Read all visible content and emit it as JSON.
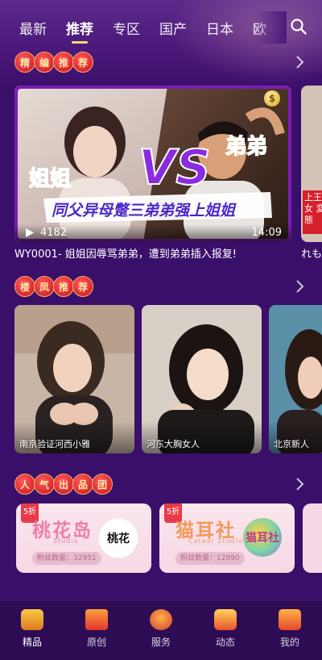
{
  "colors": {
    "background": "#3a0f6a",
    "accent": "#f4d67d",
    "section_bubble": "#c8121d",
    "featured_frame": "#7a1fb0"
  },
  "top_tabs": [
    "最新",
    "推荐",
    "专区",
    "国产",
    "日本",
    "欧"
  ],
  "active_tab": "推荐",
  "search_icon": "search-icon",
  "sections": {
    "featured": {
      "title_chars": [
        "精",
        "编",
        "推",
        "荐"
      ],
      "card": {
        "plays": "4182",
        "duration": "14:09",
        "caption": "WY0001- 姐姐因辱骂弟弟，遭到弟弟插入报复!",
        "poster": {
          "left_tag": "姐姐",
          "vs": "VS",
          "right_tag": "弟弟",
          "banner": "同父异母蹩三弟弟强上姐姐"
        }
      },
      "peek_card": {
        "caption": "れも",
        "poster_text": "上王 女 変態"
      }
    },
    "hot": {
      "title_chars": [
        "楼",
        "凤",
        "推",
        "荐"
      ],
      "photos": [
        {
          "caption": "南京验证河西小雅"
        },
        {
          "caption": "河东大胸女人"
        },
        {
          "caption": "北京新人"
        }
      ]
    },
    "studios": {
      "title_chars": [
        "人",
        "气",
        "出",
        "品",
        "团"
      ],
      "cards": [
        {
          "ribbon": "5折",
          "name": "桃花岛",
          "sub": "Studio",
          "fans_label": "粉丝数量：",
          "fans": "32951",
          "logo": "桃花"
        },
        {
          "ribbon": "5折",
          "name": "猫耳社",
          "sub": "Catear Studio",
          "fans_label": "粉丝数量：",
          "fans": "12990",
          "logo": "猫耳社"
        }
      ]
    }
  },
  "bottom_nav": [
    {
      "label": "精品",
      "icon": "premium-icon"
    },
    {
      "label": "原创",
      "icon": "original-icon"
    },
    {
      "label": "服务",
      "icon": "service-icon"
    },
    {
      "label": "动态",
      "icon": "feed-icon"
    },
    {
      "label": "我的",
      "icon": "profile-icon"
    }
  ]
}
